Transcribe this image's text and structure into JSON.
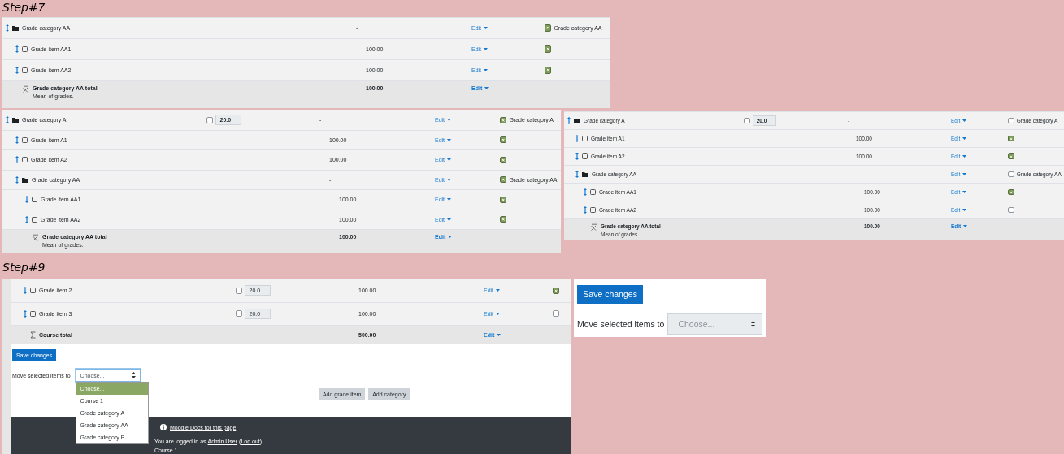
{
  "sections": [
    {
      "caption": "Step#7",
      "panels": [
        {
          "rows": [
            {
              "kind": "category",
              "name": "Grade category AA",
              "total": "-",
              "edit": "Edit",
              "include": {
                "checked": true,
                "label": "Grade category AA"
              },
              "children": [
                {
                  "kind": "item",
                  "name": "Grade item AA1",
                  "total": "100.00",
                  "edit": "Edit",
                  "include": {
                    "checked": true
                  }
                },
                {
                  "kind": "item",
                  "name": "Grade item AA2",
                  "total": "100.00",
                  "edit": "Edit",
                  "include": {
                    "checked": true
                  }
                },
                {
                  "kind": "total",
                  "name": "Grade category AA total",
                  "note": "Mean of grades.",
                  "total": "100.00",
                  "edit": "Edit"
                }
              ]
            }
          ]
        },
        {
          "rows": [
            {
              "kind": "category",
              "name": "Grade category A",
              "weight": {
                "checked": false,
                "value": "20.0"
              },
              "total": "-",
              "edit": "Edit",
              "include": {
                "checked": true,
                "label": "Grade category A"
              },
              "children": [
                {
                  "kind": "item",
                  "name": "Grade item A1",
                  "total": "100.00",
                  "edit": "Edit",
                  "include": {
                    "checked": true
                  }
                },
                {
                  "kind": "item",
                  "name": "Grade item A2",
                  "total": "100.00",
                  "edit": "Edit",
                  "include": {
                    "checked": true
                  }
                },
                {
                  "kind": "category",
                  "name": "Grade category AA",
                  "total": "-",
                  "edit": "Edit",
                  "include": {
                    "checked": true,
                    "label": "Grade category AA"
                  },
                  "children": [
                    {
                      "kind": "item",
                      "name": "Grade item AA1",
                      "total": "100.00",
                      "edit": "Edit",
                      "include": {
                        "checked": true
                      }
                    },
                    {
                      "kind": "item",
                      "name": "Grade item AA2",
                      "total": "100.00",
                      "edit": "Edit",
                      "include": {
                        "checked": true
                      }
                    },
                    {
                      "kind": "total",
                      "name": "Grade category AA total",
                      "note": "Mean of grades.",
                      "total": "100.00",
                      "edit": "Edit"
                    }
                  ]
                }
              ]
            }
          ]
        },
        {
          "rows": [
            {
              "kind": "category",
              "name": "Grade category A",
              "weight": {
                "checked": false,
                "value": "20.0"
              },
              "total": "-",
              "edit": "Edit",
              "include": {
                "checked": false,
                "label": "Grade category A"
              },
              "children": [
                {
                  "kind": "item",
                  "name": "Grade item A1",
                  "total": "100.00",
                  "edit": "Edit",
                  "include": {
                    "checked": true
                  }
                },
                {
                  "kind": "item",
                  "name": "Grade item A2",
                  "total": "100.00",
                  "edit": "Edit",
                  "include": {
                    "checked": true
                  }
                },
                {
                  "kind": "category",
                  "name": "Grade category AA",
                  "total": "-",
                  "edit": "Edit",
                  "include": {
                    "checked": false,
                    "label": "Grade category AA"
                  },
                  "children": [
                    {
                      "kind": "item",
                      "name": "Grade item AA1",
                      "total": "100.00",
                      "edit": "Edit",
                      "include": {
                        "checked": true
                      }
                    },
                    {
                      "kind": "item",
                      "name": "Grade item AA2",
                      "total": "100.00",
                      "edit": "Edit",
                      "include": {
                        "checked": false
                      }
                    },
                    {
                      "kind": "total",
                      "name": "Grade category AA total",
                      "note": "Mean of grades.",
                      "total": "100.00",
                      "edit": "Edit"
                    }
                  ]
                }
              ]
            }
          ]
        }
      ]
    },
    {
      "caption": "Step#9",
      "panels": [
        {
          "rows": [
            {
              "kind": "item",
              "name": "Grade item 2",
              "weight": {
                "checked": false,
                "value": "20.0"
              },
              "total": "100.00",
              "edit": "Edit",
              "include": {
                "checked": true
              }
            },
            {
              "kind": "item",
              "name": "Grade item 3",
              "weight": {
                "checked": false,
                "value": "20.0"
              },
              "total": "100.00",
              "edit": "Edit",
              "include": {
                "checked": false
              }
            },
            {
              "kind": "course_total",
              "name": "Course total",
              "total": "500.00",
              "edit": "Edit"
            }
          ],
          "form": {
            "save": "Save changes",
            "move_label": "Move selected items to",
            "select": {
              "value": "Choose...",
              "disabled": false,
              "open": true,
              "options": [
                {
                  "label": "Choose...",
                  "selected": true
                },
                {
                  "label": "Course 1",
                  "selected": false
                },
                {
                  "label": "Grade category A",
                  "selected": false
                },
                {
                  "label": "Grade category AA",
                  "selected": false
                },
                {
                  "label": "Grade category B",
                  "selected": false
                }
              ]
            },
            "buttons": [
              "Add grade item",
              "Add category"
            ]
          },
          "footer": {
            "docs_link": "Moodle Docs for this page",
            "login": [
              {
                "text": "You are logged in as "
              },
              {
                "link": "Admin User"
              },
              {
                "text": " ("
              },
              {
                "link": "Log out"
              },
              {
                "text": ")"
              }
            ],
            "course": "Course 1"
          }
        },
        {
          "form": {
            "save": "Save changes",
            "move_label": "Move selected items to",
            "select": {
              "value": "Choose...",
              "disabled": true,
              "open": false
            }
          }
        }
      ]
    }
  ]
}
